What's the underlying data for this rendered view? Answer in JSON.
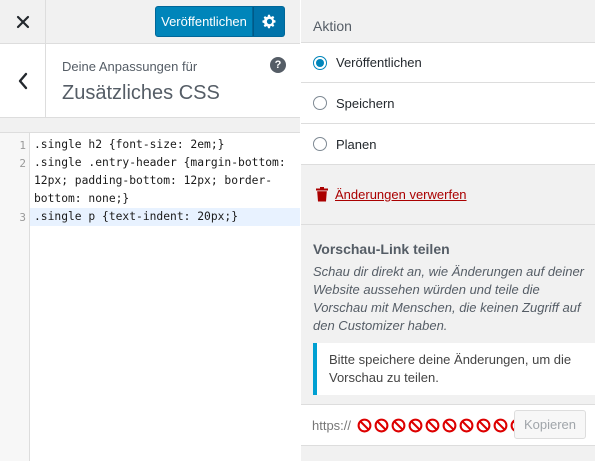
{
  "header": {
    "publish_label": "Veröffentlichen"
  },
  "section": {
    "subtitle": "Deine Anpassungen für",
    "title": "Zusätzliches CSS",
    "help_label": "?"
  },
  "editor": {
    "line_numbers": [
      "1",
      "2",
      "3"
    ],
    "lines": [
      ".single h2 {font-size: 2em;}",
      ".single .entry-header {margin-bottom: 12px; padding-bottom: 12px; border-bottom: none;}",
      ".single p {text-indent: 20px;}"
    ]
  },
  "action": {
    "label": "Aktion",
    "options": [
      {
        "label": "Veröffentlichen",
        "selected": true
      },
      {
        "label": "Speichern",
        "selected": false
      },
      {
        "label": "Planen",
        "selected": false
      }
    ],
    "discard_label": "Änderungen verwerfen"
  },
  "preview": {
    "title": "Vorschau-Link teilen",
    "description": "Schau dir direkt an, wie Änderungen auf deiner Website aussehen würden und teile die Vorschau mit Menschen, die keinen Zugriff auf den Customizer haben.",
    "notice": "Bitte speichere deine Änderungen, um die Vorschau zu teilen.",
    "url_prefix": "https://",
    "copy_label": "Kopieren"
  },
  "colors": {
    "primary": "#0085ba",
    "discard": "#aa0000",
    "notice_border": "#00a0d2"
  }
}
